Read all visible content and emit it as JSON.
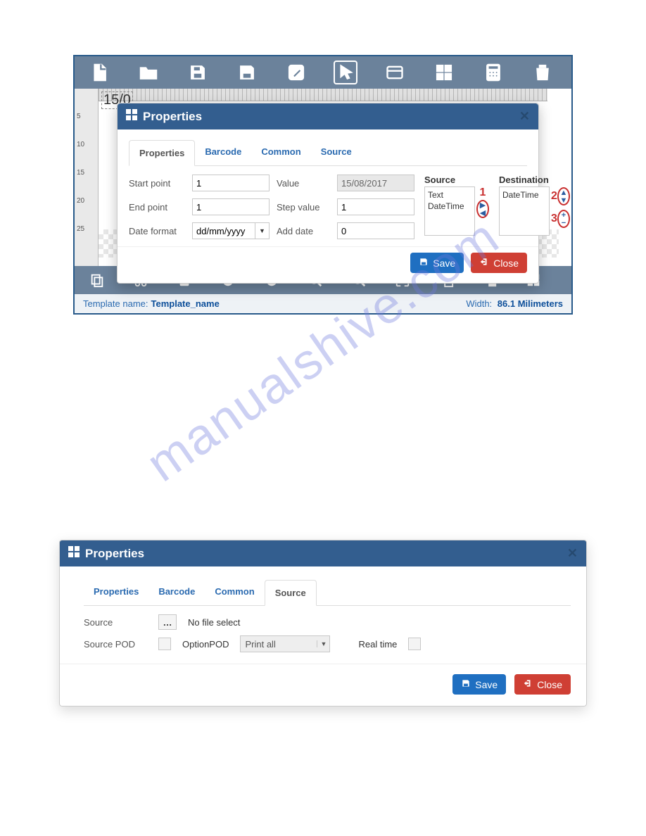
{
  "watermark": "manualshive.com",
  "panel1": {
    "canvas_date": "15/0",
    "toolbar_top": [
      "file",
      "open",
      "save",
      "save-as",
      "edit",
      "pointer",
      "form",
      "apps",
      "calculator",
      "trash"
    ],
    "toolbar_bottom": [
      "copy",
      "cut",
      "paste",
      "undo",
      "redo",
      "zoom-in",
      "zoom-out",
      "fit",
      "bring-front",
      "send-back",
      "grid"
    ],
    "dialog": {
      "title": "Properties",
      "tabs": [
        "Properties",
        "Barcode",
        "Common",
        "Source"
      ],
      "active_tab": "Properties",
      "fields": {
        "start_point_label": "Start point",
        "start_point_value": "1",
        "value_label": "Value",
        "value_value": "15/08/2017",
        "end_point_label": "End point",
        "end_point_value": "1",
        "step_label": "Step value",
        "step_value": "1",
        "date_format_label": "Date format",
        "date_format_value": "dd/mm/yyyy",
        "add_date_label": "Add date",
        "add_date_value": "0",
        "source_label": "Source",
        "source_items": [
          "Text",
          "DateTime"
        ],
        "destination_label": "Destination",
        "destination_items": [
          "DateTime"
        ]
      },
      "callouts": {
        "c1": "1",
        "c2": "2",
        "c3": "3"
      },
      "save_label": "Save",
      "close_label": "Close"
    },
    "status": {
      "template_label": "Template name:",
      "template_value": "Template_name",
      "width_label": "Width:",
      "width_value": "86.1 Milimeters"
    },
    "ruler_v": [
      "5",
      "10",
      "15",
      "20",
      "25"
    ]
  },
  "panel2": {
    "title": "Properties",
    "tabs": [
      "Properties",
      "Barcode",
      "Common",
      "Source"
    ],
    "active_tab": "Source",
    "source_label": "Source",
    "no_file": "No file select",
    "source_pod_label": "Source POD",
    "option_pod_label": "OptionPOD",
    "option_pod_value": "Print all",
    "real_time_label": "Real time",
    "save_label": "Save",
    "close_label": "Close"
  }
}
